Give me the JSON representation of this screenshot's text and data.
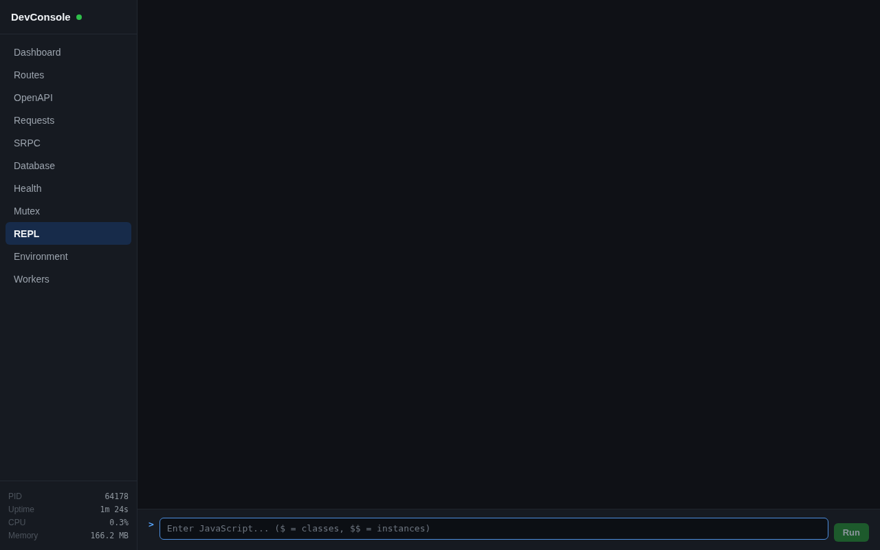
{
  "sidebar": {
    "brand": {
      "title": "DevConsole",
      "connected": true
    },
    "items": [
      {
        "label": "Dashboard",
        "selected": false
      },
      {
        "label": "Routes",
        "selected": false
      },
      {
        "label": "OpenAPI",
        "selected": false
      },
      {
        "label": "Requests",
        "selected": false
      },
      {
        "label": "SRPC",
        "selected": false
      },
      {
        "label": "Database",
        "selected": false
      },
      {
        "label": "Health",
        "selected": false
      },
      {
        "label": "Mutex",
        "selected": false
      },
      {
        "label": "REPL",
        "selected": true
      },
      {
        "label": "Environment",
        "selected": false
      },
      {
        "label": "Workers",
        "selected": false
      }
    ],
    "stats": [
      {
        "label": "PID",
        "value": "64178"
      },
      {
        "label": "Uptime",
        "value": "1m 24s"
      },
      {
        "label": "CPU",
        "value": "0.3%"
      },
      {
        "label": "Memory",
        "value": "166.2 MB"
      }
    ]
  },
  "repl": {
    "prompt": ">",
    "input": {
      "placeholder": "Enter JavaScript... ($ = classes, $$ = instances)",
      "focused": true
    },
    "run_button": {
      "label": "Run",
      "disabled": true
    }
  }
}
